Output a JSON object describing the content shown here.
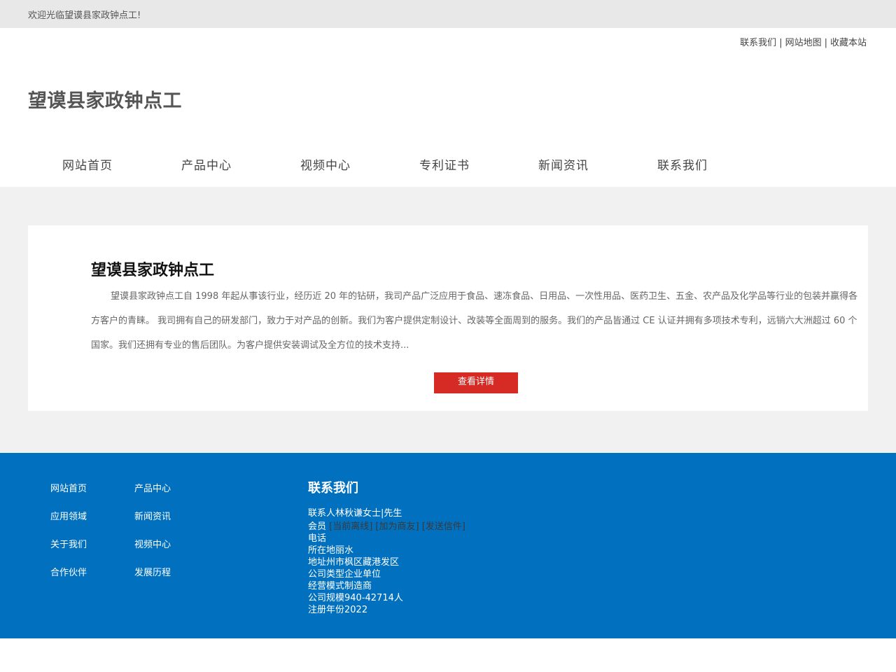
{
  "topbar": {
    "welcome": "欢迎光临望谟县家政钟点工!"
  },
  "toplinks": [
    {
      "label": "联系我们"
    },
    {
      "label": "网站地图"
    },
    {
      "label": "收藏本站"
    }
  ],
  "toplinks_sep": "|",
  "site": {
    "title": "望谟县家政钟点工"
  },
  "nav": [
    {
      "label": "网站首页"
    },
    {
      "label": "产品中心"
    },
    {
      "label": "视频中心"
    },
    {
      "label": "专利证书"
    },
    {
      "label": "新闻资讯"
    },
    {
      "label": "联系我们"
    }
  ],
  "about": {
    "title": "望谟县家政钟点工",
    "text": "望谟县家政钟点工自 1998 年起从事该行业，经历近 20 年的钻研，我司产品广泛应用于食品、速冻食品、日用品、一次性用品、医药卫生、五金、农产品及化学品等行业的包装并赢得各方客户的青睐。 我司拥有自己的研发部门，致力于对产品的创新。我们为客户提供定制设计、改装等全面周到的服务。我们的产品皆通过 CE 认证并拥有多项技术专利，远销六大洲超过 60 个国家。我们还拥有专业的售后团队。为客户提供安装调试及全方位的技术支持...",
    "button": "查看详情"
  },
  "footer": {
    "links": [
      {
        "label": "网站首页"
      },
      {
        "label": "产品中心"
      },
      {
        "label": "应用领域"
      },
      {
        "label": "新闻资讯"
      },
      {
        "label": "关于我们"
      },
      {
        "label": "视频中心"
      },
      {
        "label": "合作伙伴"
      },
      {
        "label": "发展历程"
      }
    ],
    "contact_title": "联系我们",
    "contact_person": "联系人林秋谦女士|先生",
    "member_label": "会员",
    "member_tags": "[当前离线] [加为商友] [发送信件]",
    "lines": [
      "电话",
      "所在地丽水",
      "地址州市枫区藏港发区",
      "公司类型企业单位",
      "经营模式制造商",
      "公司规模940-42714人",
      "注册年份2022"
    ]
  },
  "colors": {
    "topbar_bg": "#e8e8e8",
    "main_bg": "#f1f1f1",
    "button_red": "#d62b24",
    "footer_blue": "#0170bf"
  }
}
